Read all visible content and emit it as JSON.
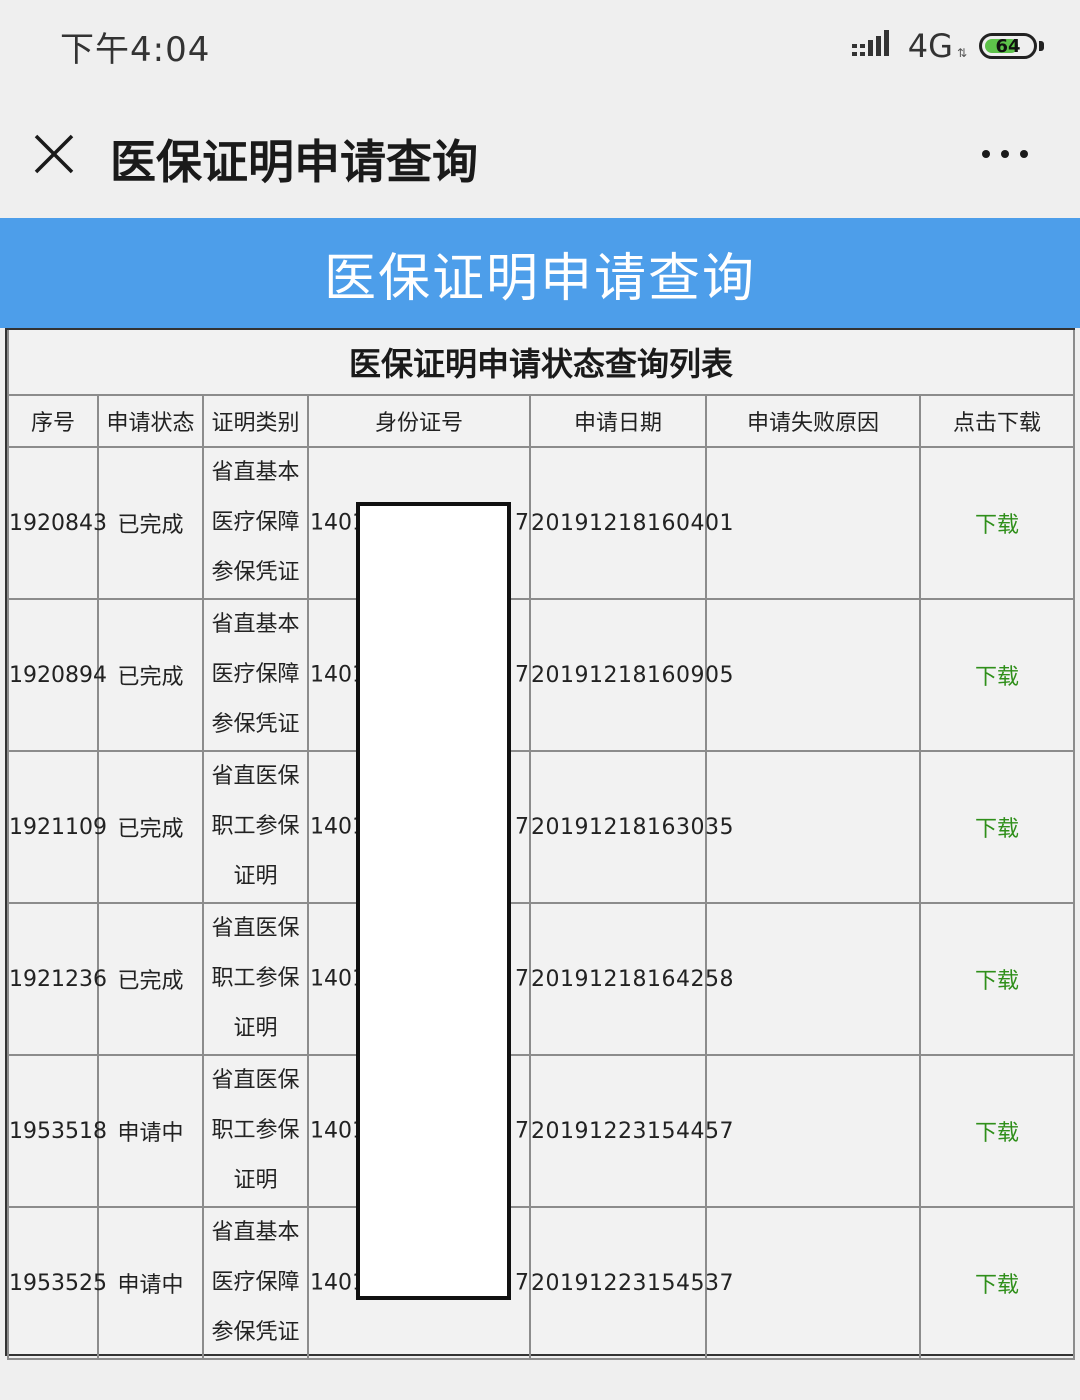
{
  "status_bar": {
    "time": "下午4:04",
    "network": "4G",
    "battery": "64",
    "battery_level_percent": 64
  },
  "nav": {
    "title": "医保证明申请查询"
  },
  "banner": {
    "title": "医保证明申请查询"
  },
  "table": {
    "caption": "医保证明申请状态查询列表",
    "headers": [
      "序号",
      "申请状态",
      "证明类别",
      "身份证号",
      "申请日期",
      "申请失败原因",
      "点击下载"
    ],
    "rows": [
      {
        "seq": "1920843",
        "status": "已完成",
        "category": [
          "省直基本",
          "医疗保障",
          "参保凭证"
        ],
        "id_prefix": "1401",
        "id_suffix": "7",
        "date": "20191218160401",
        "reason": "",
        "download": "下载"
      },
      {
        "seq": "1920894",
        "status": "已完成",
        "category": [
          "省直基本",
          "医疗保障",
          "参保凭证"
        ],
        "id_prefix": "1401",
        "id_suffix": "7",
        "date": "20191218160905",
        "reason": "",
        "download": "下载"
      },
      {
        "seq": "1921109",
        "status": "已完成",
        "category": [
          "省直医保",
          "职工参保",
          "证明"
        ],
        "id_prefix": "1401",
        "id_suffix": "7",
        "date": "20191218163035",
        "reason": "",
        "download": "下载"
      },
      {
        "seq": "1921236",
        "status": "已完成",
        "category": [
          "省直医保",
          "职工参保",
          "证明"
        ],
        "id_prefix": "1401",
        "id_suffix": "7",
        "date": "20191218164258",
        "reason": "",
        "download": "下载"
      },
      {
        "seq": "1953518",
        "status": "申请中",
        "category": [
          "省直医保",
          "职工参保",
          "证明"
        ],
        "id_prefix": "1401",
        "id_suffix": "7",
        "date": "20191223154457",
        "reason": "",
        "download": "下载"
      },
      {
        "seq": "1953525",
        "status": "申请中",
        "category": [
          "省直基本",
          "医疗保障",
          "参保凭证"
        ],
        "id_prefix": "1401",
        "id_suffix": "7",
        "date": "20191223154537",
        "reason": "",
        "download": "下载"
      }
    ]
  },
  "colors": {
    "banner": "#4d9eea",
    "download_link": "#2f8f1a",
    "battery": "#5dc24a"
  }
}
